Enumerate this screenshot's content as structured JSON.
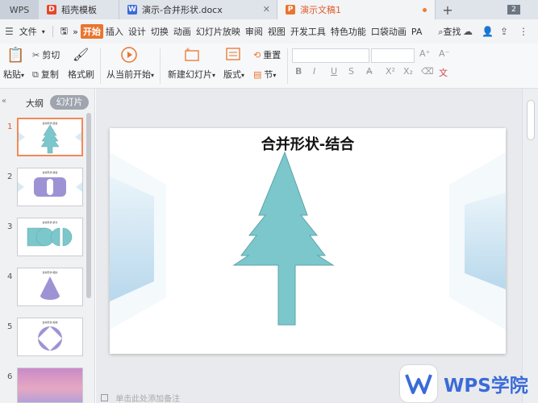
{
  "tabbar": {
    "app_button": "WPS",
    "tabs": [
      {
        "label": "稻壳模板",
        "icon": "docer-icon"
      },
      {
        "label": "演示-合并形状.docx",
        "icon": "word-doc-icon"
      },
      {
        "label": "演示文稿1",
        "icon": "presentation-icon",
        "active": true
      }
    ],
    "add_tab": "+",
    "window_count": "2"
  },
  "menubar": {
    "file_label": "文件",
    "items": [
      "开始",
      "插入",
      "设计",
      "切换",
      "动画",
      "幻灯片放映",
      "审阅",
      "视图",
      "开发工具",
      "特色功能",
      "口袋动画",
      "PA"
    ],
    "active_item": "开始",
    "search_label": "查找"
  },
  "toolbar": {
    "paste": "粘贴",
    "cut": "剪切",
    "copy": "复制",
    "format_painter": "格式刷",
    "from_current": "从当前开始",
    "new_slide": "新建幻灯片",
    "layout": "版式",
    "reset": "重置",
    "section": "节"
  },
  "leftpanel": {
    "outline_tab": "大纲",
    "slides_tab": "幻灯片",
    "thumbnails": [
      {
        "num": "1",
        "title": "合并形状-结合",
        "selected": true
      },
      {
        "num": "2",
        "title": "合并形状-组合"
      },
      {
        "num": "3",
        "title": "合并形状-拆分"
      },
      {
        "num": "4",
        "title": "合并形状-相交"
      },
      {
        "num": "5",
        "title": "合并形状-剪除"
      },
      {
        "num": "6",
        "title": ""
      }
    ]
  },
  "slide": {
    "title": "合并形状-结合",
    "tree_color": "#7cc7cb",
    "tree_stroke": "#5aa5aa"
  },
  "statusbar": {
    "notes_hint": "单击此处添加备注"
  },
  "watermark": {
    "text": "WPS学院"
  },
  "colors": {
    "accent": "#e9752e",
    "selected_thumb_border": "#f08a5a",
    "shape_purple": "#9d93d4",
    "shape_teal": "#7cc7cb"
  }
}
